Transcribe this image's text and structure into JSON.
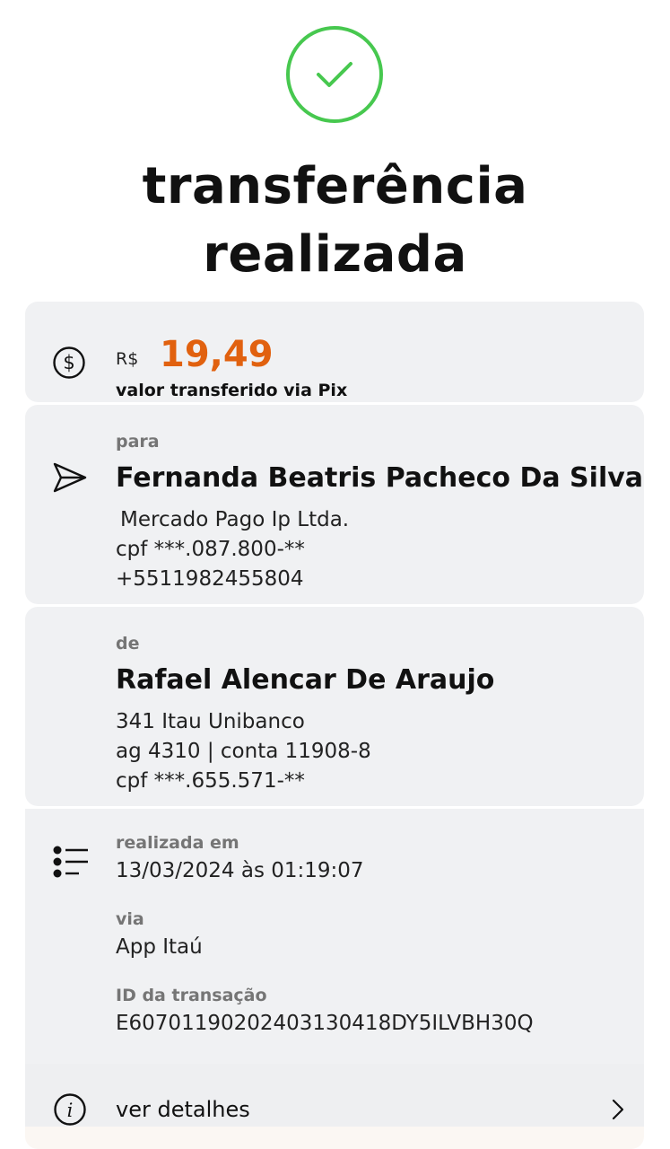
{
  "header": {
    "title_line1": "transferência",
    "title_line2": "realizada"
  },
  "amount": {
    "currency": "R$",
    "value": "19,49",
    "caption": "valor transferido via Pix"
  },
  "recipient": {
    "label": "para",
    "name": "Fernanda Beatris Pacheco Da Silva",
    "institution": "Mercado Pago Ip Ltda.",
    "cpf": "cpf ***.087.800-**",
    "phone": "+5511982455804"
  },
  "sender": {
    "label": "de",
    "name": "Rafael Alencar De Araujo",
    "bank": "341 Itau Unibanco",
    "account": "ag 4310 | conta 11908-8",
    "cpf": "cpf ***.655.571-**"
  },
  "info": {
    "date_label": "realizada em",
    "date_value": "13/03/2024 às 01:19:07",
    "via_label": "via",
    "via_value": "App Itaú",
    "id_label": "ID da transação",
    "id_value": "E60701190202403130418DY5ILVBH30Q"
  },
  "details": {
    "label": "ver detalhes"
  },
  "colors": {
    "success": "#47c84f",
    "amount": "#e1610f",
    "card_bg": "#f0f1f3"
  },
  "icons": {
    "success": "check-icon",
    "amount": "dollar-icon",
    "recipient": "send-icon",
    "info": "list-icon",
    "details": "info-icon",
    "chevron": "chevron-right-icon"
  }
}
